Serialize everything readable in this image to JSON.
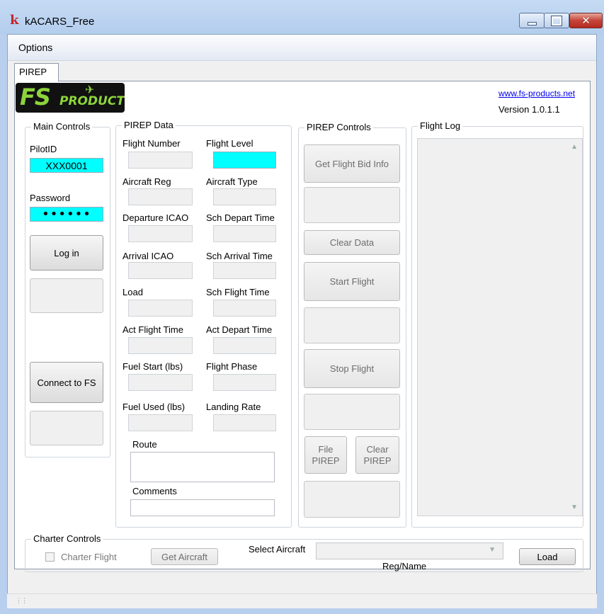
{
  "window": {
    "title": "kACARS_Free"
  },
  "menu": {
    "options": "Options"
  },
  "tab": {
    "label": "PIREP"
  },
  "header": {
    "link": "www.fs-products.net",
    "version": "Version 1.0.1.1"
  },
  "logo": {
    "fs": "FS",
    "products": "PRODUCTS"
  },
  "main_controls": {
    "title": "Main Controls",
    "pilot_label": "PilotID",
    "pilot_value": "XXX0001",
    "password_label": "Password",
    "password_value": "••••••",
    "login": "Log in",
    "connect": "Connect to FS"
  },
  "pirep_data": {
    "title": "PIREP Data",
    "flight_number": "Flight Number",
    "flight_level": "Flight Level",
    "aircraft_reg": "Aircraft Reg",
    "aircraft_type": "Aircraft Type",
    "departure_icao": "Departure ICAO",
    "sch_depart": "Sch Depart Time",
    "arrival_icao": "Arrival ICAO",
    "sch_arrival": "Sch Arrival Time",
    "load": "Load",
    "sch_flight": "Sch Flight Time",
    "act_flight": "Act Flight Time",
    "act_depart": "Act Depart Time",
    "fuel_start": "Fuel Start (lbs)",
    "flight_phase": "Flight Phase",
    "fuel_used": "Fuel Used (lbs)",
    "landing_rate": "Landing Rate",
    "route": "Route",
    "comments": "Comments"
  },
  "pirep_controls": {
    "title": "PIREP Controls",
    "get_bid": "Get Flight Bid Info",
    "clear_data": "Clear Data",
    "start_flight": "Start Flight",
    "stop_flight": "Stop Flight",
    "file_pirep_1": "File",
    "file_pirep_2": "PIREP",
    "clear_pirep_1": "Clear",
    "clear_pirep_2": "PIREP"
  },
  "flight_log": {
    "title": "Flight Log"
  },
  "charter": {
    "title": "Charter Controls",
    "charter_flight": "Charter Flight",
    "get_aircraft": "Get Aircraft",
    "select_aircraft": "Select Aircraft",
    "reg_name": "Reg/Name",
    "load": "Load"
  },
  "colors": {
    "highlight": "#00ffff",
    "link": "#0000ee"
  }
}
